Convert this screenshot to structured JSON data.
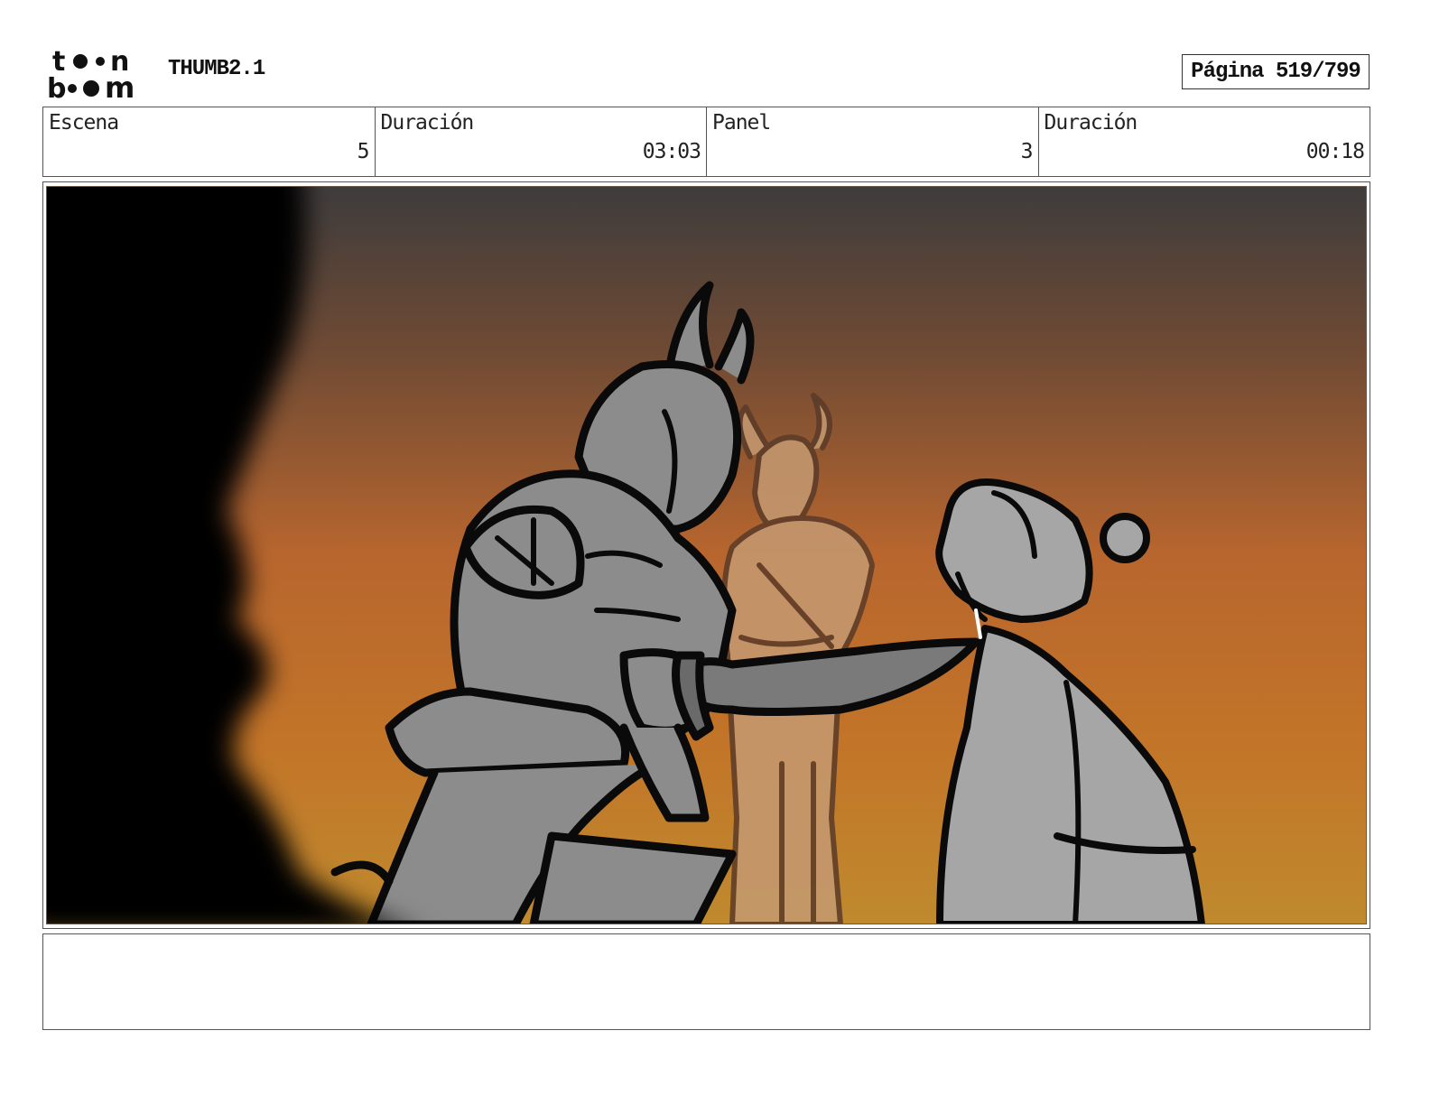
{
  "header": {
    "logo_text": "toon boom",
    "project_title": "THUMB2.1",
    "page_label": "Página 519/799"
  },
  "info": {
    "scene": {
      "label": "Escena",
      "value": "5"
    },
    "scene_duration": {
      "label": "Duración",
      "value": "03:03"
    },
    "panel": {
      "label": "Panel",
      "value": "3"
    },
    "panel_duration": {
      "label": "Duración",
      "value": "00:18"
    }
  },
  "colors": {
    "sky_top": "#3e3c3c",
    "sky_mid": "#b8662e",
    "sky_bottom": "#c08a2e",
    "silhouette": "#050505",
    "armor_gray": "#8c8c8c",
    "robe_gray": "#a6a6a6",
    "background_warrior": "#c59a72"
  },
  "icons": {
    "logo": "toon-boom-logo"
  },
  "notes": ""
}
